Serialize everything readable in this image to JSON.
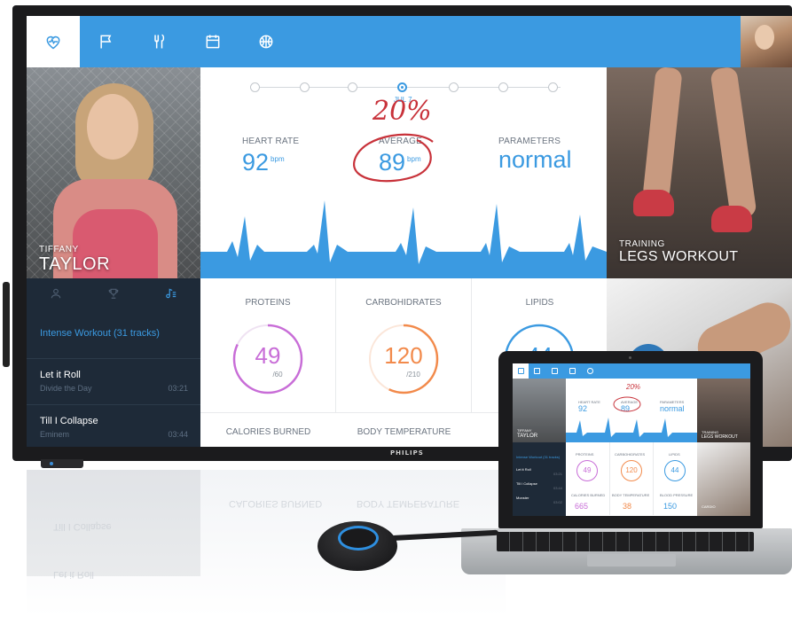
{
  "nav": {
    "items": [
      {
        "name": "heart-icon",
        "active": true
      },
      {
        "name": "flag-icon",
        "active": false
      },
      {
        "name": "utensils-icon",
        "active": false
      },
      {
        "name": "calendar-icon",
        "active": false
      },
      {
        "name": "basketball-icon",
        "active": false
      }
    ],
    "accent_color": "#3b9ae1"
  },
  "profile": {
    "first_name": "TIFFANY",
    "last_name": "TAYLOR"
  },
  "side_tabs": [
    {
      "name": "user-icon"
    },
    {
      "name": "trophy-icon"
    },
    {
      "name": "playlist-icon",
      "active": true
    }
  ],
  "playlist": {
    "title": "Intense Workout (31 tracks)",
    "tracks": [
      {
        "title": "Let it Roll",
        "artist": "Divide the Day",
        "time": "03:21"
      },
      {
        "title": "Till I Collapse",
        "artist": "Eminem",
        "time": "03:44"
      }
    ]
  },
  "timeline": {
    "selected_label": "JUL 7"
  },
  "metrics": {
    "heart_rate": {
      "label": "HEART RATE",
      "value": "92",
      "unit": "bpm"
    },
    "average": {
      "label": "AVERAGE",
      "value": "89",
      "unit": "bpm"
    },
    "parameters": {
      "label": "PARAMETERS",
      "value": "normal"
    }
  },
  "nutrition": {
    "proteins": {
      "label": "PROTEINS",
      "value": "49",
      "total": "/60",
      "fraction": 0.82,
      "color": "#c86dd7"
    },
    "carbohydrates": {
      "label": "CARBOHIDRATES",
      "value": "120",
      "total": "/210",
      "fraction": 0.57,
      "color": "#f28a4b"
    },
    "lipids": {
      "label": "LIPIDS",
      "value": "44",
      "color": "#3b9ae1"
    }
  },
  "bottom_metrics": {
    "calories": "CALORIES BURNED",
    "body_temp": "BODY TEMPERATURE"
  },
  "training": {
    "kicker": "TRAINING",
    "title": "LEGS WORKOUT"
  },
  "tv_brand": "PHILIPS",
  "annotation": {
    "percent": "20%"
  },
  "laptop": {
    "profile_first": "TIFFANY",
    "profile_last": "TAYLOR",
    "heart_rate_label": "HEART RATE",
    "heart_rate": "92",
    "average_label": "AVERAGE",
    "average": "89",
    "parameters_label": "PARAMETERS",
    "parameters": "normal",
    "playlist_title": "Intense Workout (31 tracks)",
    "tracks": [
      {
        "title": "Let it Roll",
        "time": "03:21"
      },
      {
        "title": "Till I Collapse",
        "time": "03:44"
      },
      {
        "title": "Monster",
        "time": "03:02"
      }
    ],
    "proteins_label": "PROTEINS",
    "proteins": "49",
    "carbs_label": "CARBOHIDRATES",
    "carbs": "120",
    "lipids_label": "LIPIDS",
    "lipids": "44",
    "calories_label": "CALORIES BURNED",
    "calories": "665",
    "body_temp_label": "BODY TEMPERATURE",
    "body_temp": "38",
    "blood_label": "BLOOD PRESSURE",
    "blood": "150",
    "training_kicker": "TRAINING",
    "training_title": "LEGS WORKOUT",
    "cardio": "CARDIO",
    "annotation": "20%"
  }
}
